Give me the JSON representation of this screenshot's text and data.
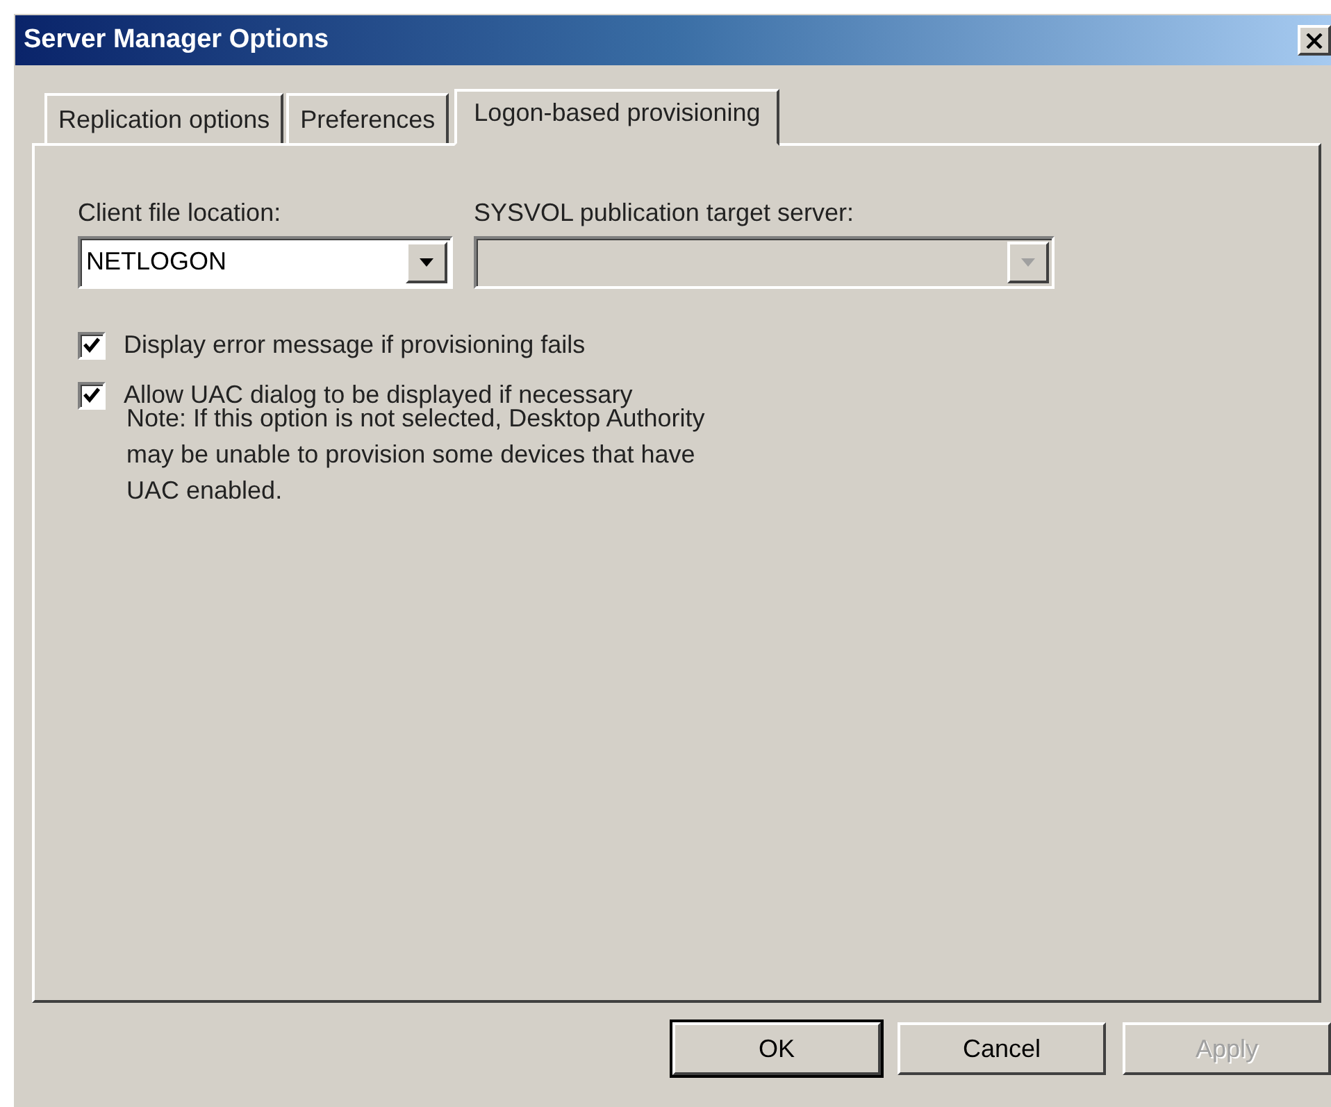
{
  "window": {
    "title": "Server Manager Options"
  },
  "tabs": [
    {
      "label": "Replication options",
      "selected": false
    },
    {
      "label": "Preferences",
      "selected": false
    },
    {
      "label": "Logon-based provisioning",
      "selected": true
    }
  ],
  "fields": [
    {
      "label": "Client file location:",
      "value": "NETLOGON",
      "disabled": false
    },
    {
      "label": "SYSVOL publication target server:",
      "disabled": true
    }
  ],
  "checkboxes": [
    {
      "label": "Display error message if provisioning fails",
      "checked": true
    },
    {
      "label": "Allow UAC dialog to be displayed if necessary",
      "checked": true
    }
  ],
  "note": "Note: If this option is not selected, Desktop Authority may be unable to provision some devices that have UAC enabled.",
  "buttons": [
    {
      "label": "OK",
      "default": true,
      "disabled": false
    },
    {
      "label": "Cancel",
      "default": false,
      "disabled": false
    },
    {
      "label": "Apply",
      "default": false,
      "disabled": true
    }
  ]
}
